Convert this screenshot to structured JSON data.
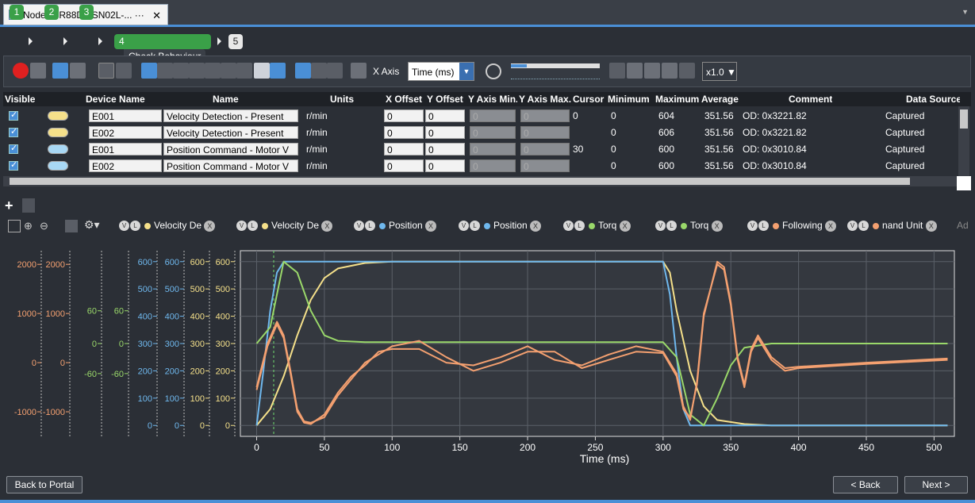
{
  "window": {
    "tab_title": "Node1 : R88D-1SN02L-...",
    "tab_menu": "···"
  },
  "steps": {
    "s1": "1",
    "s2": "2",
    "s3": "3",
    "s4": "4",
    "current_label": "Check Behaviour",
    "s5": "5"
  },
  "toolbar": {
    "xaxis_label": "X Axis",
    "xaxis_value": "Time (ms)",
    "speed_value": "x1.0",
    "dropdown_glyph": "▼"
  },
  "table": {
    "headers": [
      "Visible",
      "Device Name",
      "Name",
      "Units",
      "X Offset",
      "Y Offset",
      "Y Axis Min.",
      "Y Axis Max.",
      "Cursor",
      "Minimum",
      "Maximum",
      "Average",
      "Comment",
      "Data Source"
    ],
    "rows": [
      {
        "color": "#f5e08a",
        "device": "E001",
        "name": "Velocity Detection - Present",
        "units": "r/min",
        "xoff": "0",
        "yoff": "0",
        "ymin": "0",
        "ymax": "0",
        "cursor": "0",
        "min": "0",
        "max": "604",
        "avg": "351.56",
        "comment": "OD: 0x3221.82",
        "source": "Captured"
      },
      {
        "color": "#f5e08a",
        "device": "E002",
        "name": "Velocity Detection - Present",
        "units": "r/min",
        "xoff": "0",
        "yoff": "0",
        "ymin": "0",
        "ymax": "0",
        "cursor": "",
        "min": "0",
        "max": "606",
        "avg": "351.56",
        "comment": "OD: 0x3221.82",
        "source": "Captured"
      },
      {
        "color": "#a8d8f5",
        "device": "E001",
        "name": "Position Command - Motor V",
        "units": "r/min",
        "xoff": "0",
        "yoff": "0",
        "ymin": "0",
        "ymax": "0",
        "cursor": "30",
        "min": "0",
        "max": "600",
        "avg": "351.56",
        "comment": "OD: 0x3010.84",
        "source": "Captured"
      },
      {
        "color": "#a8d8f5",
        "device": "E002",
        "name": "Position Command - Motor V",
        "units": "r/min",
        "xoff": "0",
        "yoff": "0",
        "ymin": "0",
        "ymax": "0",
        "cursor": "",
        "min": "0",
        "max": "600",
        "avg": "351.56",
        "comment": "OD: 0x3010.84",
        "source": "Captured"
      }
    ]
  },
  "legend": {
    "items": [
      {
        "label": "Velocity De",
        "color": "#f5e08a"
      },
      {
        "label": "Velocity De",
        "color": "#f5e08a"
      },
      {
        "label": "Position",
        "color": "#6fb8ee"
      },
      {
        "label": "Position",
        "color": "#6fb8ee"
      },
      {
        "label": "Torq",
        "color": "#9ad86a"
      },
      {
        "label": "Torq",
        "color": "#9ad86a"
      },
      {
        "label": "Following",
        "color": "#f4a070"
      },
      {
        "label": "nand Unit",
        "color": "#f4a070"
      }
    ],
    "v": "V",
    "l": "L",
    "x": "X",
    "more": "Ad"
  },
  "chart_data": {
    "type": "line",
    "xlabel": "Time (ms)",
    "xlim": [
      -12,
      515
    ],
    "x_ticks": [
      0,
      50,
      100,
      150,
      200,
      250,
      300,
      350,
      400,
      450,
      500
    ],
    "y_axes": [
      {
        "color": "#f4a070",
        "ticks": [
          "2000",
          "1000",
          "0",
          "-1000"
        ]
      },
      {
        "color": "#f4a070",
        "ticks": [
          "2000",
          "1000",
          "0",
          "-1000"
        ]
      },
      {
        "color": "#9ad86a",
        "ticks": [
          "60",
          "0",
          "-60"
        ]
      },
      {
        "color": "#9ad86a",
        "ticks": [
          "60",
          "0",
          "-60"
        ]
      },
      {
        "color": "#6fb8ee",
        "ticks": [
          "600",
          "500",
          "400",
          "300",
          "200",
          "100",
          "0"
        ]
      },
      {
        "color": "#6fb8ee",
        "ticks": [
          "600",
          "500",
          "400",
          "300",
          "200",
          "100",
          "0"
        ]
      },
      {
        "color": "#f5e08a",
        "ticks": [
          "600",
          "500",
          "400",
          "300",
          "200",
          "100",
          "0"
        ]
      },
      {
        "color": "#f5e08a",
        "ticks": [
          "600",
          "500",
          "400",
          "300",
          "200",
          "100",
          "0"
        ]
      }
    ],
    "ylim": [
      -40,
      640
    ],
    "grid": true,
    "series": [
      {
        "color": "#f5e08a",
        "x": [
          0,
          10,
          20,
          30,
          40,
          50,
          60,
          80,
          100,
          300,
          305,
          310,
          320,
          330,
          340,
          360,
          380,
          510
        ],
        "y": [
          0,
          60,
          180,
          330,
          460,
          540,
          575,
          595,
          600,
          600,
          560,
          420,
          200,
          70,
          20,
          5,
          0,
          0
        ]
      },
      {
        "color": "#6fb8ee",
        "x": [
          0,
          5,
          10,
          15,
          20,
          25,
          30,
          300,
          305,
          310,
          315,
          320,
          325,
          510
        ],
        "y": [
          0,
          200,
          420,
          560,
          600,
          600,
          600,
          600,
          480,
          250,
          60,
          0,
          0,
          0
        ]
      },
      {
        "color": "#9ad86a",
        "x": [
          0,
          10,
          20,
          30,
          40,
          50,
          60,
          80,
          300,
          310,
          320,
          330,
          340,
          350,
          360,
          380,
          510
        ],
        "y": [
          300,
          360,
          600,
          560,
          420,
          330,
          310,
          305,
          305,
          250,
          40,
          0,
          100,
          220,
          285,
          300,
          300
        ]
      },
      {
        "color": "#f4a070",
        "x": [
          0,
          8,
          15,
          20,
          25,
          30,
          35,
          40,
          50,
          60,
          70,
          80,
          90,
          100,
          120,
          140,
          160,
          180,
          200,
          220,
          240,
          260,
          280,
          300,
          310,
          315,
          320,
          325,
          330,
          340,
          345,
          350,
          355,
          360,
          365,
          370,
          380,
          390,
          400,
          450,
          510
        ],
        "y": [
          140,
          300,
          380,
          330,
          200,
          60,
          15,
          10,
          30,
          110,
          170,
          230,
          260,
          290,
          310,
          250,
          200,
          230,
          270,
          270,
          210,
          240,
          270,
          265,
          180,
          60,
          30,
          150,
          400,
          600,
          580,
          450,
          250,
          150,
          280,
          330,
          250,
          210,
          215,
          230,
          245
        ]
      },
      {
        "color": "#f4a070",
        "x": [
          0,
          8,
          15,
          20,
          25,
          30,
          35,
          40,
          50,
          60,
          70,
          80,
          90,
          100,
          120,
          140,
          160,
          180,
          200,
          220,
          240,
          260,
          280,
          300,
          310,
          315,
          320,
          325,
          330,
          340,
          345,
          350,
          355,
          360,
          365,
          370,
          380,
          390,
          400,
          450,
          510
        ],
        "y": [
          130,
          290,
          370,
          320,
          190,
          50,
          10,
          5,
          40,
          120,
          180,
          220,
          270,
          280,
          280,
          230,
          220,
          250,
          290,
          240,
          220,
          260,
          290,
          270,
          190,
          70,
          20,
          160,
          410,
          590,
          570,
          440,
          240,
          140,
          270,
          320,
          240,
          200,
          210,
          225,
          240
        ]
      }
    ]
  },
  "footer": {
    "back_portal": "Back to Portal",
    "back": "< Back",
    "next": "Next >"
  }
}
